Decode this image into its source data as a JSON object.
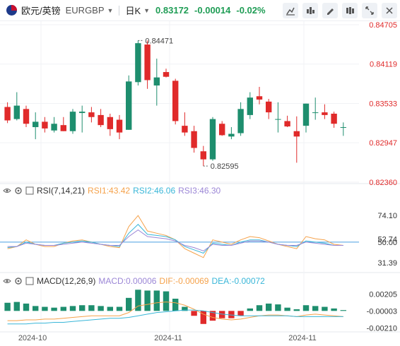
{
  "header": {
    "pair": "欧元/英镑",
    "symbol": "EURGBP",
    "timeframe": "日K",
    "price": "0.83172",
    "change": "-0.00014",
    "change_pct": "-0.02%",
    "tools": [
      "candle-style-icon",
      "indicator-icon",
      "draw-icon",
      "settings-icon",
      "fullscreen-icon",
      "close-icon"
    ]
  },
  "colors": {
    "up": "#1e8e6e",
    "down": "#e02a2a",
    "rsi1": "#f5a24b",
    "rsi2": "#38b6d8",
    "rsi3": "#9b86d6",
    "macd": "#f5a24b",
    "dea": "#38b6d8"
  },
  "price_axis": {
    "ticks": [
      "0.84705",
      "0.84119",
      "0.83533",
      "0.82947",
      "0.82360"
    ]
  },
  "annotations": {
    "high": "0.84471",
    "low": "0.82595"
  },
  "rsi": {
    "title": "RSI(7,14,21)",
    "rsi1": "RSI1:43.42",
    "rsi2": "RSI2:46.06",
    "rsi3": "RSI3:46.30",
    "ticks": [
      "74.10",
      "52.74",
      "50.00",
      "31.39"
    ]
  },
  "macd": {
    "title": "MACD(12,26,9)",
    "macd": "MACD:0.00006",
    "dif": "DIF:-0.00069",
    "dea": "DEA:-0.00072",
    "ticks": [
      "0.00205",
      "-0.00003",
      "-0.00210"
    ]
  },
  "x_axis": {
    "ticks": [
      "2024-10",
      "2024-11",
      "2024-11"
    ]
  },
  "chart_data": {
    "type": "candlestick",
    "ylim": [
      0.8236,
      0.84705
    ],
    "candles": [
      [
        0.8348,
        0.8328,
        0.8355,
        0.8324
      ],
      [
        0.833,
        0.835,
        0.837,
        0.8328
      ],
      [
        0.8345,
        0.8323,
        0.835,
        0.8318
      ],
      [
        0.8318,
        0.8326,
        0.834,
        0.83
      ],
      [
        0.8326,
        0.8316,
        0.8333,
        0.831
      ],
      [
        0.8313,
        0.8323,
        0.8333,
        0.831
      ],
      [
        0.8321,
        0.8312,
        0.8333,
        0.8312
      ],
      [
        0.8312,
        0.8341,
        0.8345,
        0.8308
      ],
      [
        0.8339,
        0.8341,
        0.835,
        0.831
      ],
      [
        0.834,
        0.8333,
        0.8348,
        0.8325
      ],
      [
        0.8336,
        0.8321,
        0.8345,
        0.8318
      ],
      [
        0.8333,
        0.8315,
        0.8338,
        0.8305
      ],
      [
        0.8329,
        0.831,
        0.8336,
        0.83
      ],
      [
        0.8314,
        0.8386,
        0.8395,
        0.8314
      ],
      [
        0.8385,
        0.8443,
        0.8447,
        0.838
      ],
      [
        0.8441,
        0.8388,
        0.8447,
        0.8375
      ],
      [
        0.838,
        0.8392,
        0.842,
        0.835
      ],
      [
        0.84,
        0.8393,
        0.8405,
        0.8392
      ],
      [
        0.8387,
        0.8327,
        0.839,
        0.8322
      ],
      [
        0.832,
        0.831,
        0.834,
        0.8305
      ],
      [
        0.8312,
        0.8287,
        0.832,
        0.828
      ],
      [
        0.8282,
        0.827,
        0.829,
        0.826
      ],
      [
        0.827,
        0.833,
        0.8333,
        0.8268
      ],
      [
        0.8323,
        0.8306,
        0.8327,
        0.8305
      ],
      [
        0.8304,
        0.8308,
        0.8318,
        0.83
      ],
      [
        0.8309,
        0.8345,
        0.8355,
        0.8305
      ],
      [
        0.8336,
        0.8362,
        0.837,
        0.833
      ],
      [
        0.8364,
        0.8359,
        0.8378,
        0.8352
      ],
      [
        0.8356,
        0.834,
        0.836,
        0.833
      ],
      [
        0.833,
        0.833,
        0.8355,
        0.831
      ],
      [
        0.8327,
        0.8319,
        0.8335,
        0.8318
      ],
      [
        0.8312,
        0.8304,
        0.8334,
        0.8265
      ],
      [
        0.832,
        0.8353,
        0.8353,
        0.831
      ],
      [
        0.834,
        0.834,
        0.8362,
        0.8329
      ],
      [
        0.834,
        0.8336,
        0.8352,
        0.833
      ],
      [
        0.8338,
        0.8323,
        0.8341,
        0.8317
      ],
      [
        0.8318,
        0.8318,
        0.8325,
        0.8305
      ]
    ],
    "rsi1": [
      44,
      46,
      52,
      48,
      46,
      46,
      49,
      51,
      52,
      50,
      48,
      46,
      45,
      64,
      74,
      60,
      58,
      56,
      52,
      44,
      40,
      36,
      52,
      50,
      48,
      52,
      55,
      54,
      51,
      48,
      46,
      44,
      55,
      53,
      52,
      48,
      47
    ],
    "rsi2": [
      45,
      46,
      50,
      48,
      47,
      47,
      49,
      50,
      51,
      50,
      48,
      47,
      46,
      58,
      66,
      57,
      56,
      55,
      52,
      46,
      43,
      40,
      49,
      48,
      47,
      50,
      52,
      52,
      50,
      48,
      47,
      46,
      51,
      50,
      49,
      47,
      47
    ],
    "rsi3": [
      46,
      46,
      49,
      48,
      47,
      47,
      48,
      49,
      50,
      49,
      48,
      47,
      47,
      55,
      61,
      55,
      54,
      53,
      51,
      47,
      45,
      42,
      48,
      47,
      47,
      49,
      51,
      51,
      50,
      48,
      47,
      47,
      50,
      49,
      48,
      47,
      47
    ],
    "macd_hist": [
      0.001,
      0.0011,
      0.0009,
      0.0006,
      0.0005,
      0.0004,
      0.0005,
      0.0006,
      0.0007,
      0.0007,
      0.0006,
      0.0005,
      0.0005,
      0.0016,
      0.0026,
      0.0025,
      0.0025,
      0.0024,
      0.0015,
      0.0005,
      -0.0006,
      -0.0016,
      -0.0012,
      -0.0009,
      -0.0009,
      -0.0006,
      0.0003,
      0.0007,
      0.0009,
      0.0008,
      0.0004,
      0.0002,
      0.0007,
      0.0006,
      0.0005,
      0.0003,
      0.0001
    ],
    "dif": [
      -0.0012,
      -0.0012,
      -0.0011,
      -0.0011,
      -0.001,
      -0.001,
      -0.0009,
      -0.0008,
      -0.0007,
      -0.0006,
      -0.0006,
      -0.0006,
      -0.0006,
      -0.0002,
      0.0006,
      0.0008,
      0.001,
      0.0011,
      0.001,
      0.0007,
      0.0002,
      -0.0004,
      -0.0008,
      -0.001,
      -0.0011,
      -0.001,
      -0.0008,
      -0.0006,
      -0.0005,
      -0.0005,
      -0.0006,
      -0.0007,
      -0.0005,
      -0.0004,
      -0.0005,
      -0.0006,
      -0.0007
    ],
    "dea": [
      -0.0016,
      -0.0016,
      -0.0016,
      -0.0015,
      -0.0015,
      -0.0014,
      -0.0014,
      -0.0013,
      -0.0012,
      -0.0011,
      -0.001,
      -0.0009,
      -0.0009,
      -0.0008,
      -0.0006,
      -0.0004,
      -0.0002,
      -0.0001,
      0.0,
      0.0001,
      0.0001,
      0.0,
      -0.0002,
      -0.0004,
      -0.0005,
      -0.0006,
      -0.0006,
      -0.0006,
      -0.0006,
      -0.0006,
      -0.0006,
      -0.0007,
      -0.0007,
      -0.0007,
      -0.0007,
      -0.0007,
      -0.0007
    ]
  }
}
